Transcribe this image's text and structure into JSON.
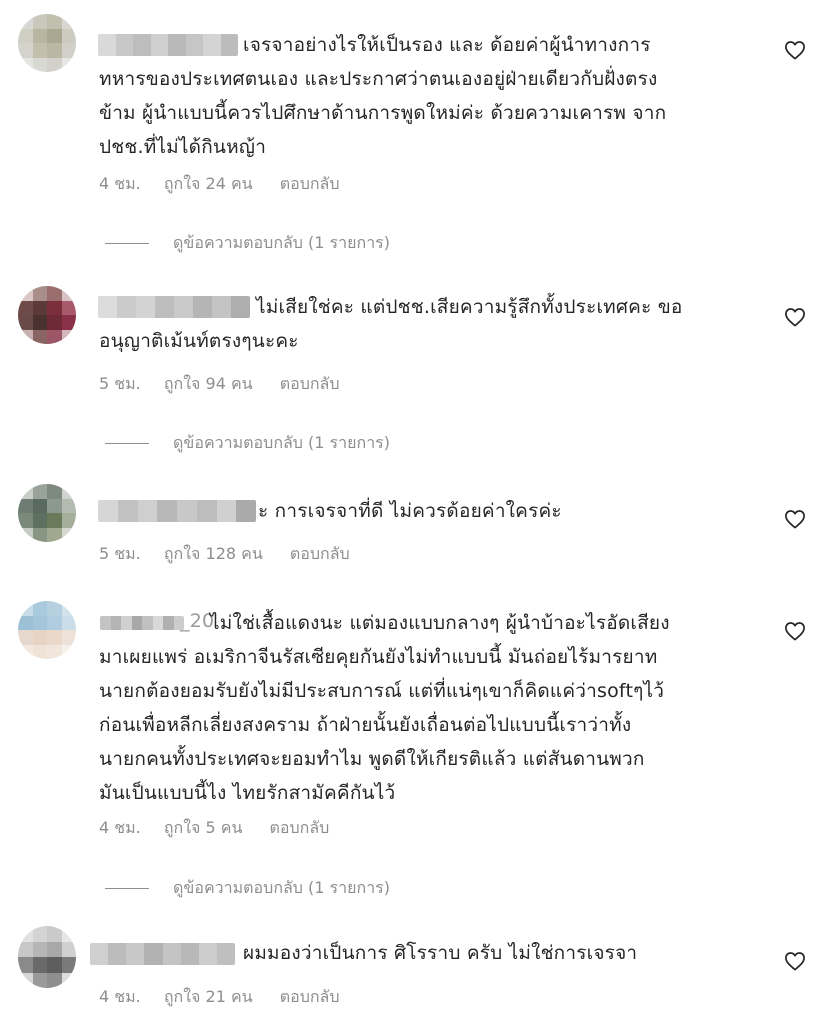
{
  "comments": [
    {
      "lines": [
        "เจรจาอย่างไรให้เป็นรอง และ ด้อยค่าผู้นำทางการ",
        "ทหารของประเทศตนเอง และประกาศว่าตนเองอยู่ฝ่ายเดียวกับฝั่งตรง",
        "ข้าม ผู้นำแบบนี้ควรไปศึกษาด้านการพูดใหม่ค่ะ ด้วยความเคารพ จาก",
        "ปชช.ที่ไม่ได้กินหญ้า"
      ],
      "time": "4 ชม.",
      "likes": "ถูกใจ 24 คน",
      "reply": "ตอบกลับ",
      "view_replies": "ดูข้อความตอบกลับ (1 รายการ)",
      "avatar_colors": [
        "#d8d8d4",
        "#c9c8bd",
        "#c0bfae",
        "#d7d6cf",
        "#cfcfc4",
        "#b8b6a0",
        "#a9a78f",
        "#cccbc0",
        "#d4d4cc",
        "#c2c0ad",
        "#bab8a5",
        "#d1d0c8",
        "#e4e4e0",
        "#d9d9d3",
        "#d2d2cb",
        "#e6e6e2"
      ],
      "name_colors": [
        "#d9d9d9",
        "#c8c8c8",
        "#bdbdbd",
        "#cfcfcf",
        "#b9b9b9",
        "#c6c6c6",
        "#d4d4d4",
        "#bcbcbc"
      ]
    },
    {
      "lines": [
        "ไม่เสียใช่คะ แต่ปชช.เสียความรู้สึกทั้งประเทศคะ ขอ",
        "อนุญาติเม้นท์ตรงๆนะคะ"
      ],
      "time": "5 ชม.",
      "likes": "ถูกใจ 94 คน",
      "reply": "ตอบกลับ",
      "view_replies": "ดูข้อความตอบกลับ (1 รายการ)",
      "avatar_colors": [
        "#d9c8c6",
        "#a98e8a",
        "#9a6e6c",
        "#d7c3c2",
        "#6e4a48",
        "#5c3a38",
        "#7c2e3c",
        "#a85a6a",
        "#6a4a46",
        "#4a3230",
        "#6e2a36",
        "#8a3048",
        "#c8b0ae",
        "#8a6462",
        "#9c5666",
        "#d4b8be"
      ],
      "name_colors": [
        "#dcdcdc",
        "#cbcbcb",
        "#d3d3d3",
        "#bebebe",
        "#c9c9c9",
        "#b5b5b5",
        "#c4c4c4",
        "#aeaeae"
      ]
    },
    {
      "lines": [
        "ะ การเจรจาที่ดี ไม่ควรด้อยค่าใครค่ะ"
      ],
      "time": "5 ชม.",
      "likes": "ถูกใจ 128 คน",
      "reply": "ตอบกลับ",
      "view_replies": "",
      "avatar_colors": [
        "#c9cec8",
        "#9aa39a",
        "#7e8a80",
        "#cfd3cd",
        "#6f7c74",
        "#5a6a62",
        "#8c9a8e",
        "#b4bcb2",
        "#7a8a7a",
        "#5e7060",
        "#6a7a5a",
        "#a4ae9a",
        "#c6cbc4",
        "#8a9684",
        "#a0a890",
        "#d4d8d0"
      ],
      "name_colors": [
        "#d6d6d6",
        "#c2c2c2",
        "#cfcfcf",
        "#b8b8b8",
        "#c8c8c8",
        "#bdbdbd",
        "#d0d0d0",
        "#aaaaaa"
      ]
    },
    {
      "lines": [
        "ไม่ใช่เสื้อแดงนะ แต่มองแบบกลางๆ ผู้นำบ้าอะไรอัดเสียง",
        "มาเผยแพร่ อเมริกาจีนรัสเซียคุยกันยังไม่ทำแบบนี้ มันถ่อยไร้มารยาท",
        "นายกต้องยอมรับยังไม่มีประสบการณ์ แต่ที่แน่ๆเขาก็คิดแค่ว่าsoftๆไว้",
        "ก่อนเพื่อหลีกเลี่ยงสงคราม ถ้าฝ่ายนั้นยังเถื่อนต่อไปแบบนี้เราว่าทั้ง",
        "นายกคนทั้งประเทศจะยอมทำไม พูดดีให้เกียรติแล้ว แต่สันดานพวก",
        "มันเป็นแบบนี้ไง ไทยรักสามัคคีกันไว้"
      ],
      "time": "4 ชม.",
      "likes": "ถูกใจ 5 คน",
      "reply": "ตอบกลับ",
      "view_replies": "ดูข้อความตอบกลับ (1 รายการ)",
      "username_fragment": "_20",
      "avatar_colors": [
        "#c8dce8",
        "#a9c9dc",
        "#b6d0e0",
        "#d2e2ea",
        "#9cc0d6",
        "#a4c6da",
        "#b0cce0",
        "#cadde8",
        "#e6d8cc",
        "#e8d4c4",
        "#ead8ca",
        "#eee2d8",
        "#f2e8e0",
        "#efe3d8",
        "#f0e6dc",
        "#f6f0ea"
      ],
      "name_colors": [
        "#c4c4c4",
        "#b4b4b4",
        "#d0d0d0",
        "#a8a8a8",
        "#c0c0c0",
        "#d8d8d8",
        "#b0b0b0",
        "#cccccc"
      ]
    },
    {
      "lines": [
        "ผมมองว่าเป็นการ ศิโรราบ ครับ ไม่ใช่การเจรจา"
      ],
      "time": "4 ชม.",
      "likes": "ถูกใจ 21 คน",
      "reply": "ตอบกลับ",
      "view_replies": "",
      "avatar_colors": [
        "#e2e2e2",
        "#d4d4d4",
        "#cacaca",
        "#e6e6e6",
        "#c8c8c8",
        "#b6b6b6",
        "#a8a8a8",
        "#d0d0d0",
        "#8a8a8a",
        "#6a6a6a",
        "#5e5e5e",
        "#7a7a7a",
        "#d6d6d6",
        "#9a9a9a",
        "#8e8e8e",
        "#dcdcdc"
      ],
      "name_colors": [
        "#cfcfcf",
        "#bcbcbc",
        "#c8c8c8",
        "#b2b2b2",
        "#c4c4c4",
        "#b8b8b8",
        "#cdcdcd",
        "#bfbfbf"
      ]
    }
  ],
  "icons": {
    "like": "heart-icon"
  }
}
